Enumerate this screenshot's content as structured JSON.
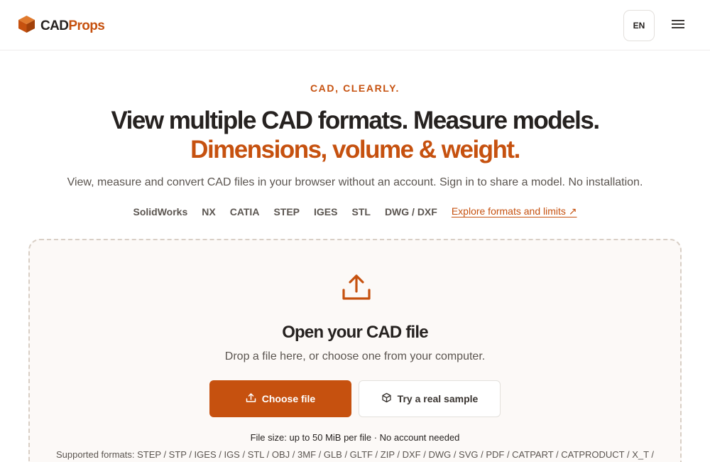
{
  "header": {
    "logo_part1": "CAD",
    "logo_part2": "Props",
    "lang_label": "EN",
    "logo_icon": "cube-icon",
    "menu_icon": "hamburger-menu-icon"
  },
  "hero": {
    "eyebrow": "CAD, CLEARLY.",
    "headline": "View multiple CAD formats. Measure models.",
    "headline_accent": "Dimensions, volume & weight.",
    "subhead": "View, measure and convert CAD files in your browser without an account. Sign in to share a model. No installation.",
    "formats": [
      "SolidWorks",
      "NX",
      "CATIA",
      "STEP",
      "IGES",
      "STL",
      "DWG / DXF"
    ],
    "explore_link": "Explore formats and limits ↗"
  },
  "dropzone": {
    "icon": "upload-icon",
    "title": "Open your CAD file",
    "subtitle": "Drop a file here, or choose one from your computer.",
    "choose_label": "Choose file",
    "sample_label": "Try a real sample",
    "filesize_note": "File size: up to 50 MiB per file · No account needed",
    "supported_formats": "Supported formats: STEP / STP / IGES / IGS / STL / OBJ / 3MF / GLB / GLTF / ZIP / DXF / DWG / SVG / PDF / CATPART / CATPRODUCT / X_T /"
  },
  "colors": {
    "accent": "#c6510f",
    "text": "#262220",
    "muted": "#5b5550",
    "dropzone_bg": "#fcf9f7"
  }
}
